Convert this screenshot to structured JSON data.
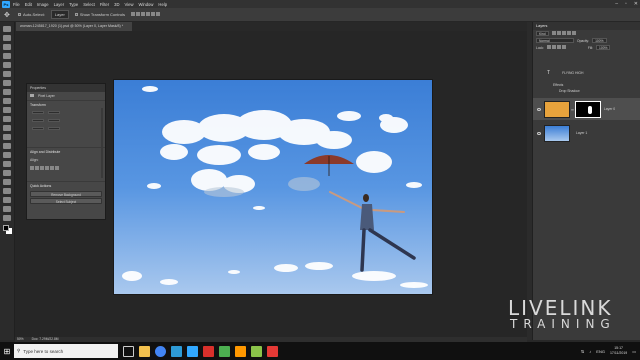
{
  "menubar": {
    "logo": "Ps",
    "items": [
      "File",
      "Edit",
      "Image",
      "Layer",
      "Type",
      "Select",
      "Filter",
      "3D",
      "View",
      "Window",
      "Help"
    ]
  },
  "options": {
    "auto_select": "Auto-Select:",
    "auto_select_mode": "Layer",
    "show_transform": "Show Transform Controls"
  },
  "document": {
    "tab_title": "woman-1245817_1920 (1).psd @ 50% (Layer 0, Layer Mask/8) *"
  },
  "status": {
    "zoom": "50%",
    "doc_size": "Doc: 7.29M/22.8M"
  },
  "properties": {
    "title": "Properties",
    "kind": "Pixel Layer",
    "transform_label": "Transform",
    "align_label": "Align and Distribute",
    "align_sub": "Align:",
    "quick_actions_label": "Quick Actions",
    "remove_bg": "Remove Background",
    "select_subject": "Select Subject"
  },
  "layers": {
    "title": "Layers",
    "kind_filter": "Kind",
    "blend_mode": "Normal",
    "opacity_label": "Opacity:",
    "opacity_value": "100%",
    "lock_label": "Lock:",
    "fill_label": "Fill:",
    "fill_value": "100%",
    "text_layer": "FLYING HIGH",
    "effects_label": "Effects",
    "drop_shadow": "Drop Shadow",
    "layer0": "Layer 0",
    "layer1": "Layer 1"
  },
  "taskbar": {
    "search_placeholder": "Type here to search",
    "time": "15:17",
    "date": "17/11/2019",
    "lang": "ENG"
  },
  "watermark": {
    "line1": "LIVELINK",
    "line2": "TRAINING"
  },
  "colors": {
    "ps_blue": "#31a8ff",
    "sky_top": "#3b7ed6",
    "umbrella": "#8b3a2a",
    "thumb_orange": "#e8a33c"
  }
}
